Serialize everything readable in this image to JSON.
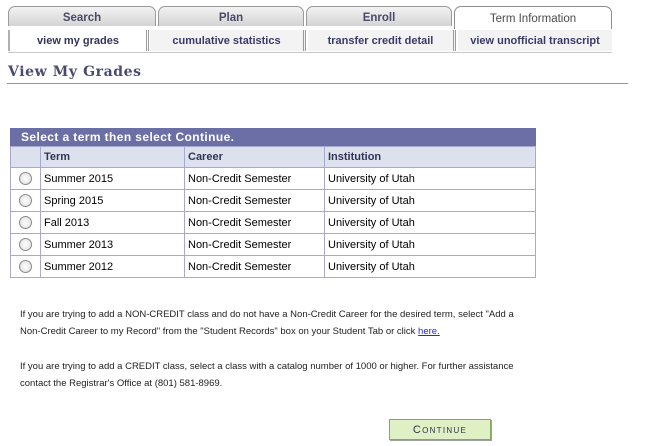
{
  "tabs": [
    {
      "label": "Search"
    },
    {
      "label": "Plan"
    },
    {
      "label": "Enroll"
    },
    {
      "label": "Term Information"
    }
  ],
  "subnav": [
    {
      "label": "view my grades"
    },
    {
      "label": "cumulative statistics"
    },
    {
      "label": "transfer credit detail"
    },
    {
      "label": "view unofficial transcript"
    }
  ],
  "page": {
    "title": "View My Grades"
  },
  "grid": {
    "header": "Select a term then select Continue.",
    "columns": [
      "Term",
      "Career",
      "Institution"
    ],
    "rows": [
      {
        "term": "Summer 2015",
        "career": "Non-Credit Semester",
        "institution": "University of Utah"
      },
      {
        "term": "Spring 2015",
        "career": "Non-Credit Semester",
        "institution": "University of Utah"
      },
      {
        "term": "Fall 2013",
        "career": "Non-Credit Semester",
        "institution": "University of Utah"
      },
      {
        "term": "Summer 2013",
        "career": "Non-Credit Semester",
        "institution": "University of Utah"
      },
      {
        "term": "Summer 2012",
        "career": "Non-Credit Semester",
        "institution": "University of Utah"
      }
    ]
  },
  "notes": {
    "noncredit_line1": "If you are trying to add a NON-CREDIT class and do not have a Non-Credit Career for the desired term, select \"Add a",
    "noncredit_line2": "Non-Credit Career to my Record\" from the \"Student Records\" box on your Student Tab or click ",
    "noncredit_link": "here.",
    "credit_line1": "If you are trying to add a CREDIT class, select a class with a catalog number of 1000 or higher. For further assistance",
    "credit_line2": "contact the Registrar's Office at (801) 581-8969."
  },
  "continue_label": "Continue"
}
